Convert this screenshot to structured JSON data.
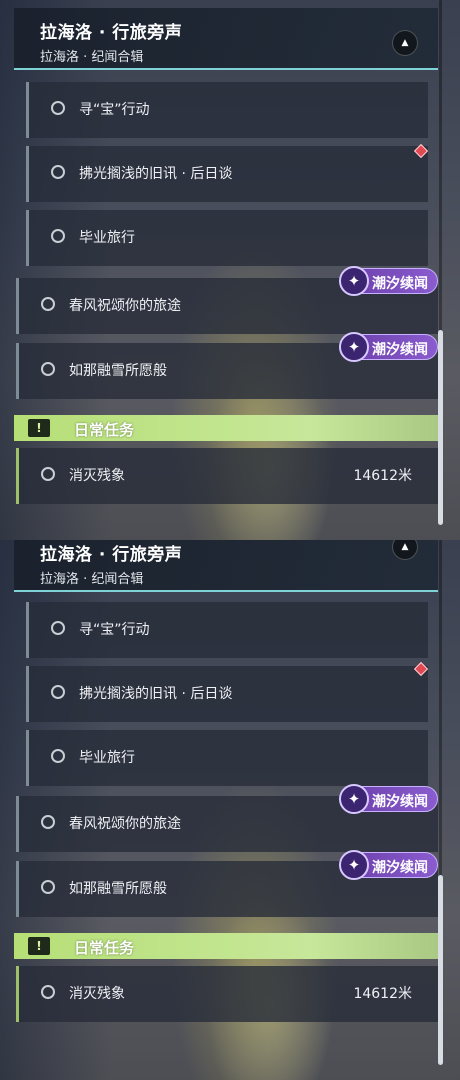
{
  "panels": [
    {
      "header": {
        "title": "拉海洛 · 行旅旁声",
        "subtitle": "拉海洛 · 纪闻合辑",
        "collapse_icon": "chevron-up-icon"
      },
      "quests": [
        {
          "label": "寻“宝”行动"
        },
        {
          "label": "拂光搁浅的旧讯 · 后日谈"
        },
        {
          "label": "毕业旅行"
        },
        {
          "label": "春风祝颂你的旅途"
        },
        {
          "label": "如那融雪所愿般"
        }
      ],
      "badges": [
        {
          "label": "潮汐续闻"
        },
        {
          "label": "潮汐续闻"
        }
      ],
      "daily": {
        "label": "日常任务",
        "icon": "!"
      },
      "daily_quest": {
        "label": "消灭残象",
        "distance": "14612米"
      },
      "colors": {
        "marker": "#e04a55",
        "badge": "#7b4fc0",
        "daily": "#b6df76"
      }
    },
    {
      "header": {
        "title": "拉海洛 · 行旅旁声",
        "subtitle": "拉海洛 · 纪闻合辑",
        "collapse_icon": "chevron-up-icon"
      },
      "quests": [
        {
          "label": "寻“宝”行动"
        },
        {
          "label": "拂光搁浅的旧讯 · 后日谈"
        },
        {
          "label": "毕业旅行"
        },
        {
          "label": "春风祝颂你的旅途"
        },
        {
          "label": "如那融雪所愿般"
        }
      ],
      "badges": [
        {
          "label": "潮汐续闻"
        },
        {
          "label": "潮汐续闻"
        }
      ],
      "daily": {
        "label": "日常任务",
        "icon": "!"
      },
      "daily_quest": {
        "label": "消灭残象",
        "distance": "14612米"
      },
      "colors": {
        "marker": "#e04a55",
        "badge": "#7b4fc0",
        "daily": "#b6df76"
      }
    }
  ]
}
